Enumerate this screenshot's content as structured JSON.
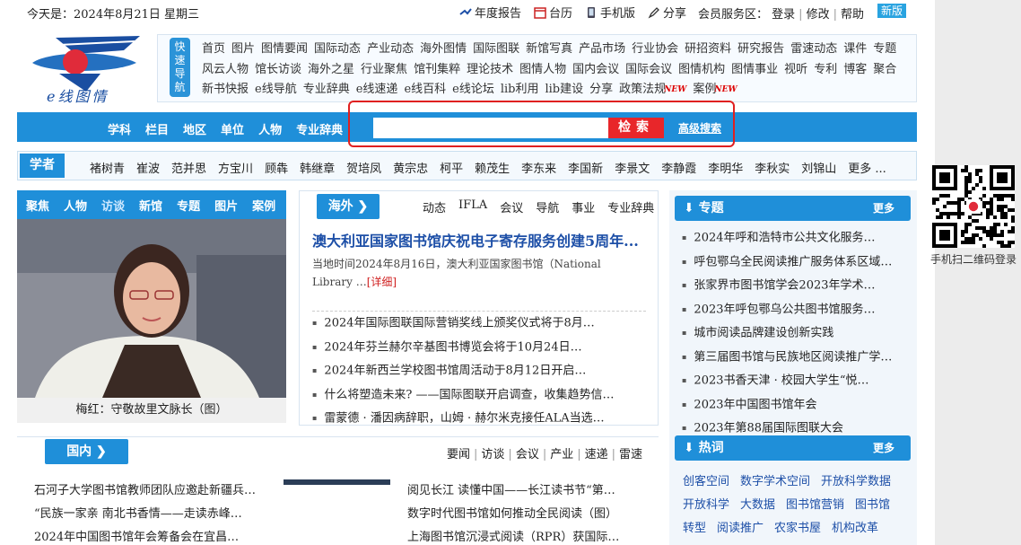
{
  "top": {
    "date": "今天是：2024年8月21日 星期三",
    "links": [
      "年度报告",
      "台历",
      "手机版",
      "分享"
    ],
    "member_label": "会员服务区：",
    "member_links": [
      "登录",
      "修改",
      "帮助"
    ],
    "new_version": "新版"
  },
  "logo": {
    "text": "e线图情"
  },
  "quicknav": {
    "label": "快速导航",
    "links": [
      "首页",
      "图片",
      "图情要闻",
      "国际动态",
      "产业动态",
      "海外图情",
      "国际图联",
      "新馆写真",
      "产品市场",
      "行业协会",
      "研招资料",
      "研究报告",
      "雷速动态",
      "课件",
      "专题",
      "风云人物",
      "馆长访谈",
      "海外之星",
      "行业聚焦",
      "馆刊集粹",
      "理论技术",
      "图情人物",
      "国内会议",
      "国际会议",
      "图情机构",
      "图情事业",
      "视听",
      "专利",
      "博客",
      "聚合",
      "新书快报",
      "e线导航",
      "专业辞典",
      "e线速递",
      "e线百科",
      "e线论坛",
      "lib利用",
      "lib建设",
      "分享",
      "政策法规",
      "案例"
    ],
    "new_tag": "NEW"
  },
  "search": {
    "categories": [
      "学科",
      "栏目",
      "地区",
      "单位",
      "人物",
      "专业辞典"
    ],
    "placeholder": "",
    "button": "检索",
    "advanced": "高级搜索"
  },
  "scholars": {
    "label": "学者",
    "names": [
      "褚树青",
      "崔波",
      "范并思",
      "方宝川",
      "顾犇",
      "韩继章",
      "贺培凤",
      "黄宗忠",
      "柯平",
      "赖茂生",
      "李东来",
      "李国新",
      "李景文",
      "李静霞",
      "李明华",
      "李秋实",
      "刘锦山"
    ],
    "more": "更多 ..."
  },
  "focus": {
    "tabs": [
      "聚焦",
      "人物",
      "访谈",
      "新馆",
      "专题",
      "图片",
      "案例"
    ],
    "active": "访谈",
    "caption": "梅红：守敬故里文脉长（图）"
  },
  "overseas": {
    "tab": "海外 ❯",
    "subtabs": [
      "动态",
      "IFLA",
      "会议",
      "导航",
      "事业",
      "专业辞典"
    ],
    "headline": "澳大利亚国家图书馆庆祝电子寄存服务创建5周年...",
    "summary": "当地时间2024年8月16日，澳大利亚国家图书馆（National Library …",
    "detail": "[详细]",
    "items": [
      "2024年国际图联国际营销奖线上颁奖仪式将于8月…",
      "2024年芬兰赫尔辛基图书博览会将于10月24日…",
      "2024年新西兰学校图书馆周活动于8月12日开启…",
      "什么将塑造未来? ——国际图联开启调查，收集趋势信…",
      "雷蒙德 · 潘因病辞职，山姆 · 赫尔米克接任ALA当选…"
    ]
  },
  "domestic": {
    "tab": "国内 ❯",
    "subtabs": [
      "要闻",
      "访谈",
      "会议",
      "产业",
      "速递",
      "雷速"
    ],
    "left": [
      "石河子大学图书馆教师团队应邀赴新疆兵…",
      "“民族一家亲 南北书香情——走读赤峰…",
      "2024年中国图书馆年会筹备会在宜昌…"
    ],
    "right": [
      "阅见长江 读懂中国——长江读书节“第…",
      "数字时代图书馆如何推动全民阅读（图）",
      "上海图书馆沉浸式阅读（RPR）获国际…"
    ]
  },
  "topics": {
    "title": "专题",
    "more": "更多",
    "items": [
      "2024年呼和浩特市公共文化服务…",
      "呼包鄂乌全民阅读推广服务体系区域…",
      "张家界市图书馆学会2023年学术…",
      "2023年呼包鄂乌公共图书馆服务…",
      "城市阅读品牌建设创新实践",
      "第三届图书馆与民族地区阅读推广学…",
      "2023书香天津 · 校园大学生“悦…",
      "2023年中国图书馆年会",
      "2023年第88届国际图联大会"
    ]
  },
  "hot": {
    "title": "热词",
    "more": "更多",
    "words": [
      "创客空间",
      "数字学术空间",
      "开放科学数据",
      "开放科学",
      "大数据",
      "图书馆营销",
      "图书馆",
      "转型",
      "阅读推广",
      "农家书屋",
      "机构改革"
    ]
  },
  "qr": {
    "caption": "手机扫二维码登录"
  }
}
